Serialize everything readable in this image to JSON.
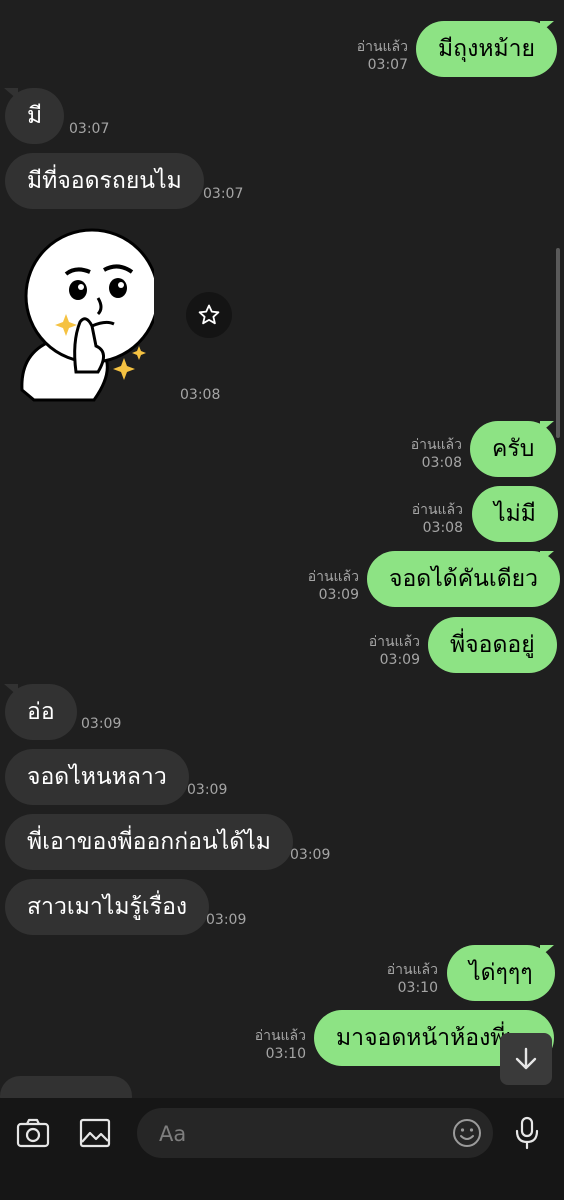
{
  "read_label": "อ่านแล้ว",
  "messages": [
    {
      "text": "มีถุงหม้าย",
      "time": "03:07"
    },
    {
      "text": "มี",
      "time": "03:07"
    },
    {
      "text": "มีที่จอดรถยนไม",
      "time": "03:07"
    },
    {
      "sticker": "thinking-face-sticker",
      "time": "03:08"
    },
    {
      "text": "ครับ",
      "time": "03:08"
    },
    {
      "text": "ไม่มี",
      "time": "03:08"
    },
    {
      "text": "จอดได้คันเดียว",
      "time": "03:09"
    },
    {
      "text": "พี่จอดอยู่",
      "time": "03:09"
    },
    {
      "text": "อ่อ",
      "time": "03:09"
    },
    {
      "text": "จอดไหนหลาว",
      "time": "03:09"
    },
    {
      "text": "พี่เอาของพี่ออกก่อนได้ไม",
      "time": "03:09"
    },
    {
      "text": "สาวเมาไมรู้เรื่อง",
      "time": "03:09"
    },
    {
      "text": "ได่ๆๆๆ",
      "time": "03:10"
    },
    {
      "text": "มาจอดหน้าห้องพี่เ",
      "time": "03:10"
    }
  ],
  "composer": {
    "placeholder": "Aa"
  },
  "icons": [
    "camera-icon",
    "image-icon",
    "emoji-icon",
    "microphone-icon",
    "star-icon",
    "arrow-down-icon"
  ],
  "colors": {
    "background": "#1f1f1f",
    "outgoing_bubble": "#8de384",
    "incoming_bubble": "#323232"
  }
}
